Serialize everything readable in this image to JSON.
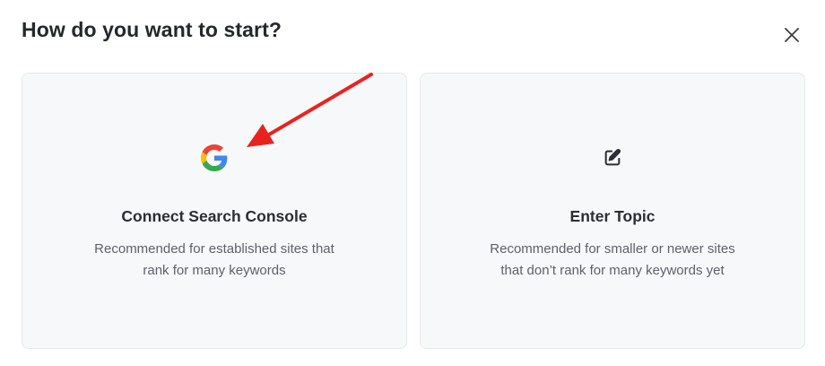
{
  "dialog": {
    "title": "How do you want to start?",
    "close_icon": "close-icon"
  },
  "options": [
    {
      "icon": "google-g-icon",
      "title": "Connect Search Console",
      "description_line1": "Recommended for established sites that",
      "description_line2": "rank for many keywords"
    },
    {
      "icon": "edit-icon",
      "title": "Enter Topic",
      "description_line1": "Recommended for smaller or newer sites",
      "description_line2": "that don’t rank for many keywords yet"
    }
  ],
  "colors": {
    "card_background": "#f7f8fa",
    "card_border": "#e6e8ec",
    "annotation_arrow": "#e8231f",
    "google_blue": "#4285F4",
    "google_red": "#EA4335",
    "google_yellow": "#FBBC05",
    "google_green": "#34A853"
  }
}
